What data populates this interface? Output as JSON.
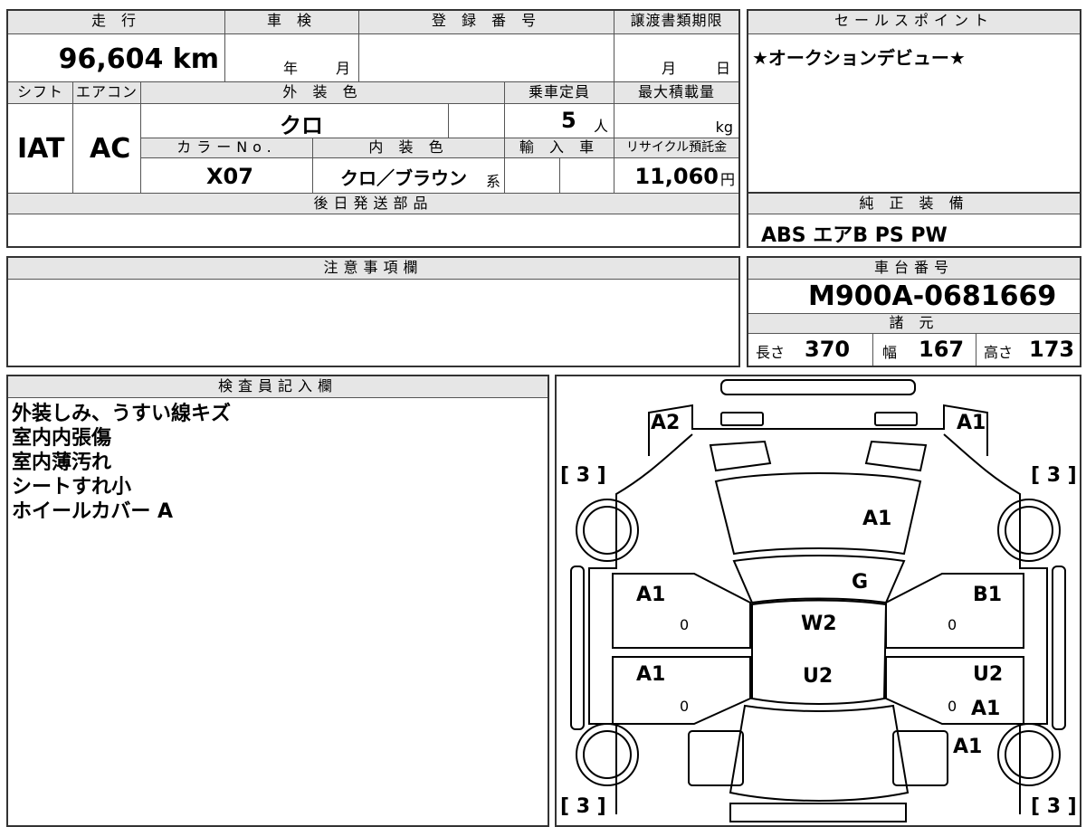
{
  "mileage": {
    "label": "走 行",
    "value": "96,604 km"
  },
  "inspection": {
    "label": "車 検",
    "year_unit": "年",
    "month_unit": "月"
  },
  "registration": {
    "label": "登 録 番 号",
    "value": ""
  },
  "transfer": {
    "label": "譲渡書類期限",
    "month_unit": "月",
    "day_unit": "日"
  },
  "sales_point": {
    "label": "セールスポイント",
    "text": "★オークションデビュー★"
  },
  "shift": {
    "label": "シフト",
    "value": "IAT"
  },
  "aircon": {
    "label": "エアコン",
    "value": "AC"
  },
  "exterior_color": {
    "label": "外 装 色",
    "value": "クロ"
  },
  "capacity": {
    "label": "乗車定員",
    "value": "5",
    "unit": "人"
  },
  "max_load": {
    "label": "最大積載量",
    "unit": "kg"
  },
  "color_no": {
    "label": "カラーNo.",
    "value": "X07"
  },
  "interior_color": {
    "label": "内 装 色",
    "value": "クロ／ブラウン",
    "suffix": "系"
  },
  "import": {
    "label": "輸 入 車"
  },
  "recycle": {
    "label": "リサイクル預託金",
    "value": "11,060",
    "unit": "円"
  },
  "later_parts": {
    "label": "後日発送部品"
  },
  "equipment": {
    "label": "純 正 装 備",
    "value": "ABS エアB PS PW"
  },
  "caution": {
    "label": "注意事項欄"
  },
  "chassis": {
    "label": "車台番号",
    "value": "M900A-0681669"
  },
  "specs": {
    "label": "諸 元",
    "length_label": "長さ",
    "length": "370",
    "width_label": "幅",
    "width": "167",
    "height_label": "高さ",
    "height": "173"
  },
  "inspector": {
    "label": "検査員記入欄",
    "lines": [
      "外装しみ、うすい線キズ",
      "室内内張傷",
      "室内薄汚れ",
      "シートすれ小",
      "ホイールカバー A"
    ]
  },
  "diagram": {
    "tire_marks": [
      "[ 3 ]",
      "[ 3 ]",
      "[ 3 ]",
      "[ 3 ]"
    ],
    "marks": [
      "A2",
      "A1",
      "A1",
      "G",
      "A1",
      "B1",
      "W2",
      "A1",
      "U2",
      "U2",
      "A1",
      "A1"
    ],
    "zeros": [
      "0",
      "0",
      "0",
      "0"
    ]
  }
}
